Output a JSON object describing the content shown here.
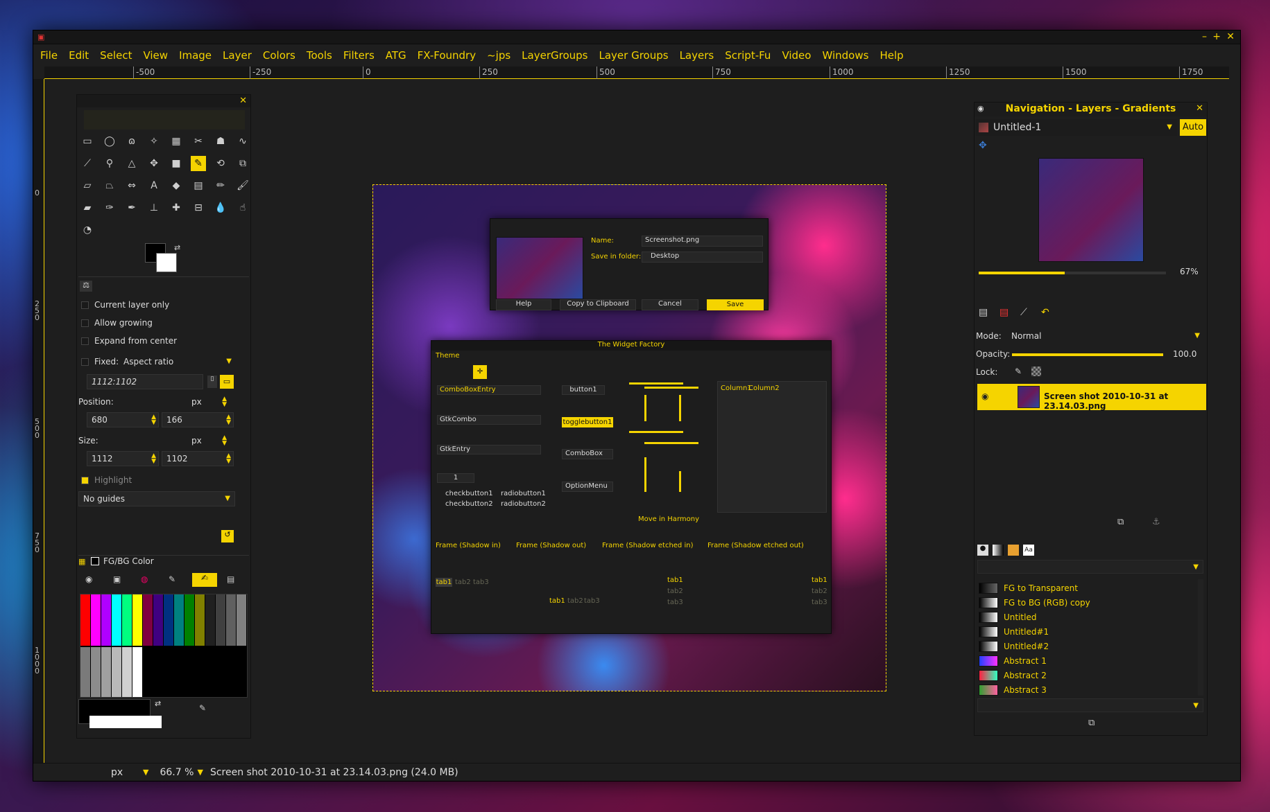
{
  "window": {
    "title": "",
    "controls": [
      "–",
      "+",
      "✕"
    ]
  },
  "menu": [
    "File",
    "Edit",
    "Select",
    "View",
    "Image",
    "Layer",
    "Colors",
    "Tools",
    "Filters",
    "ATG",
    "FX-Foundry",
    "~jps",
    "LayerGroups",
    "Layer Groups",
    "Layers",
    "Script-Fu",
    "Video",
    "Windows",
    "Help"
  ],
  "ruler": {
    "h_labels": [
      "-500",
      "-250",
      "0",
      "250",
      "500",
      "750",
      "1000",
      "1250",
      "1500",
      "1750"
    ],
    "v_labels": [
      "0",
      "250",
      "500",
      "750",
      "1000"
    ]
  },
  "toolbox": {
    "options": {
      "current_layer_only": "Current layer only",
      "allow_growing": "Allow growing",
      "expand_from_center": "Expand from center",
      "fixed_label": "Fixed:",
      "fixed_mode": "Aspect ratio",
      "ratio_value": "1112:1102",
      "position_label": "Position:",
      "position_unit": "px",
      "pos_x": "680",
      "pos_y": "166",
      "size_label": "Size:",
      "size_unit": "px",
      "size_w": "1112",
      "size_h": "1102",
      "highlight": "Highlight",
      "guides": "No guides"
    },
    "fgbg_title": "FG/BG Color",
    "palette_colors": [
      "#ff0000",
      "#ff00ff",
      "#b000ff",
      "#00ffff",
      "#00ff80",
      "#ffff00",
      "#800040",
      "#400080",
      "#003080",
      "#008080",
      "#008000",
      "#808000",
      "#202020",
      "#404040",
      "#606060",
      "#808080"
    ],
    "grays": [
      "#7a7a7a",
      "#8c8c8c",
      "#a0a0a0",
      "#b8b8b8",
      "#d0d0d0",
      "#ffffff"
    ]
  },
  "image_dialogs": {
    "save": {
      "name_label": "Name:",
      "name_value": "Screenshot.png",
      "folder_label": "Save in folder:",
      "folder_value": "Desktop",
      "help": "Help",
      "copy": "Copy to Clipboard",
      "cancel": "Cancel",
      "save": "Save"
    },
    "widget_factory": {
      "title": "The Widget Factory",
      "theme": "Theme",
      "combobox_entry": "ComboBoxEntry",
      "gtk_combo": "GtkCombo",
      "gtk_entry": "GtkEntry",
      "spin_value": "1",
      "check1": "checkbutton1",
      "check2": "checkbutton2",
      "radio1": "radiobutton1",
      "radio2": "radiobutton2",
      "button1": "button1",
      "toggle1": "togglebutton1",
      "combobox": "ComboBox",
      "option_menu": "OptionMenu",
      "move_harmony": "Move in Harmony",
      "col1": "Column1",
      "col2": "Column2",
      "frames": [
        "Frame (Shadow in)",
        "Frame (Shadow out)",
        "Frame (Shadow etched in)",
        "Frame (Shadow etched out)"
      ],
      "tabs": [
        "tab1",
        "tab2",
        "tab3"
      ]
    }
  },
  "dock": {
    "title": "Navigation - Layers - Gradients",
    "image_name": "Untitled-1",
    "auto": "Auto",
    "zoom": "67%",
    "mode_label": "Mode:",
    "mode_value": "Normal",
    "opacity_label": "Opacity:",
    "opacity_value": "100.0",
    "lock_label": "Lock:",
    "layer_name": "Screen shot 2010-10-31 at 23.14.03.png",
    "gradients": [
      {
        "name": "FG to Transparent",
        "colors": "#000000,#666666"
      },
      {
        "name": "FG to BG (RGB) copy",
        "colors": "#000000,#ffffff"
      },
      {
        "name": "Untitled",
        "colors": "#000000,#ffffff"
      },
      {
        "name": "Untitled#1",
        "colors": "#000000,#ffffff"
      },
      {
        "name": "Untitled#2",
        "colors": "#000000,#ffffff"
      },
      {
        "name": "Abstract 1",
        "colors": "#2040ff,#ff30ff"
      },
      {
        "name": "Abstract 2",
        "colors": "#ff2040,#30ffc0"
      },
      {
        "name": "Abstract 3",
        "colors": "#30a030,#ff60a0"
      }
    ]
  },
  "status": {
    "unit": "px",
    "zoom": "66.7 %",
    "info": "Screen shot 2010-10-31 at 23.14.03.png (24.0 MB)"
  }
}
